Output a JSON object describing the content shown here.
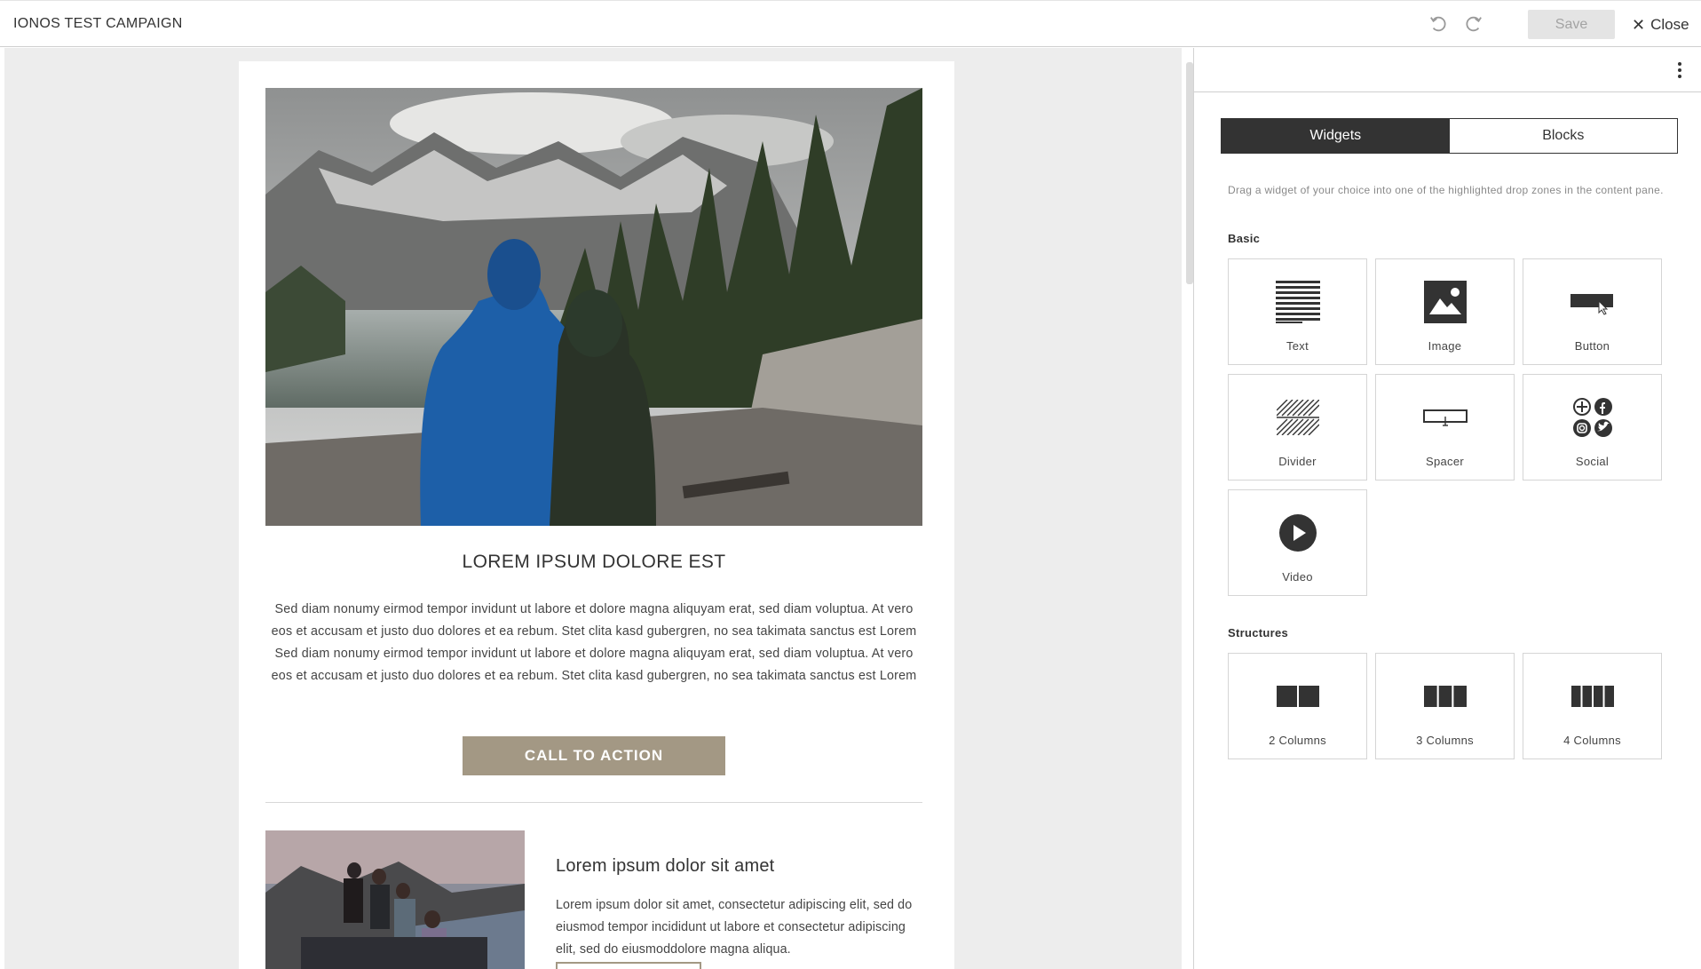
{
  "app": {
    "title": "IONOS TEST CAMPAIGN",
    "save_label": "Save",
    "close_label": "Close"
  },
  "email": {
    "headline": "LOREM IPSUM DOLORE EST",
    "body": "Sed diam nonumy eirmod tempor invidunt ut labore et dolore magna aliquyam erat, sed diam voluptua. At vero eos et accusam et justo duo dolores et ea rebum. Stet clita kasd gubergren, no sea takimata sanctus est Lorem Sed diam nonumy eirmod tempor invidunt ut labore et dolore magna aliquyam erat, sed diam voluptua. At vero eos et accusam et justo duo dolores et ea rebum. Stet clita kasd gubergren, no sea takimata sanctus est Lorem",
    "cta_label": "CALL TO ACTION",
    "sub_headline": "Lorem ipsum dolor sit amet",
    "sub_body": "Lorem ipsum dolor sit amet, consectetur adipiscing elit, sed do eiusmod tempor incididunt ut labore et consectetur adipiscing elit, sed do eiusmoddolore magna aliqua."
  },
  "panel": {
    "tabs": [
      {
        "label": "Widgets",
        "active": true
      },
      {
        "label": "Blocks",
        "active": false
      }
    ],
    "helper_text": "Drag a widget of your choice into one of the highlighted drop zones in the content pane.",
    "basic_label": "Basic",
    "basic_widgets": [
      {
        "label": "Text",
        "icon": "text-lines-icon"
      },
      {
        "label": "Image",
        "icon": "image-icon"
      },
      {
        "label": "Button",
        "icon": "button-icon"
      },
      {
        "label": "Divider",
        "icon": "hatched-divider-icon"
      },
      {
        "label": "Spacer",
        "icon": "spacer-icon"
      },
      {
        "label": "Social",
        "icon": "social-icons-icon"
      },
      {
        "label": "Video",
        "icon": "play-icon"
      }
    ],
    "structures_label": "Structures",
    "structures": [
      {
        "label": "2 Columns",
        "icon": "two-columns-icon"
      },
      {
        "label": "3 Columns",
        "icon": "three-columns-icon"
      },
      {
        "label": "4 Columns",
        "icon": "four-columns-icon"
      }
    ]
  },
  "colors": {
    "accent_dark": "#333333",
    "cta_background": "#a39884",
    "pane_background": "#ededed",
    "save_disabled": "#e4e4e4"
  }
}
